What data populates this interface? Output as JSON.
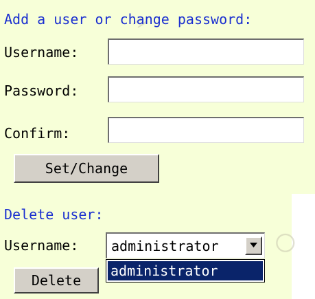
{
  "add_section": {
    "heading": "Add a user or change password:",
    "username_label": "Username:",
    "username_value": "",
    "password_label": "Password:",
    "password_value": "",
    "confirm_label": "Confirm:",
    "confirm_value": "",
    "set_button_label": "Set/Change"
  },
  "delete_section": {
    "heading": "Delete user:",
    "username_label": "Username:",
    "selected_user": "administrator",
    "dropdown_options": [
      "administrator"
    ],
    "delete_button_label": "Delete"
  },
  "colors": {
    "panel_background": "#f7ffd8",
    "heading_text": "#1a2fd0",
    "selection_highlight": "#0a246a"
  }
}
